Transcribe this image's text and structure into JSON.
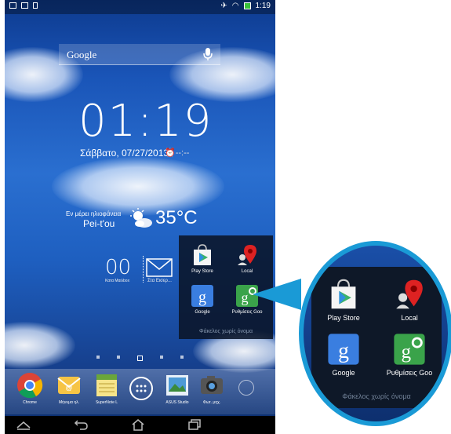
{
  "status_bar": {
    "time": "1:19"
  },
  "search": {
    "placeholder": "Google"
  },
  "clock": {
    "time": "01:19",
    "date": "Σάββατο, 07/27/2013",
    "alarm": "--:--"
  },
  "weather": {
    "description": "Εν μέρει ηλιοφάνεια",
    "city": "Pei-t'ou",
    "temperature": "35°C"
  },
  "mail": {
    "count": "00",
    "label_left": "Κατα Μαιλbox",
    "label_right": "Στα Εισερ..."
  },
  "folder": {
    "name": "Φάκελος χωρίς όνομα",
    "apps": [
      {
        "label": "Play Store",
        "icon": "play-store-icon"
      },
      {
        "label": "Local",
        "icon": "local-icon"
      },
      {
        "label": "Google",
        "icon": "google-icon"
      },
      {
        "label": "Ρυθμίσεις Goo",
        "icon": "google-settings-icon"
      }
    ]
  },
  "zoom_folder": {
    "name": "Φάκελος χωρίς όνομα",
    "apps": [
      {
        "label": "Play Store"
      },
      {
        "label": "Local"
      },
      {
        "label": "Google"
      },
      {
        "label": "Ρυθμίσεις Goo"
      }
    ]
  },
  "dock": [
    {
      "label": "Chrome",
      "icon": "chrome-icon"
    },
    {
      "label": "Μήνυμα ηλ.",
      "icon": "email-icon"
    },
    {
      "label": "SuperNote L",
      "icon": "supernote-icon"
    },
    {
      "label": "",
      "icon": "app-drawer-icon"
    },
    {
      "label": "ASUS Studio",
      "icon": "asus-studio-icon"
    },
    {
      "label": "Φωτ. μηχ.",
      "icon": "camera-icon"
    }
  ],
  "colors": {
    "accent": "#1a9ad6",
    "wallpaper": "#1a55b8"
  }
}
